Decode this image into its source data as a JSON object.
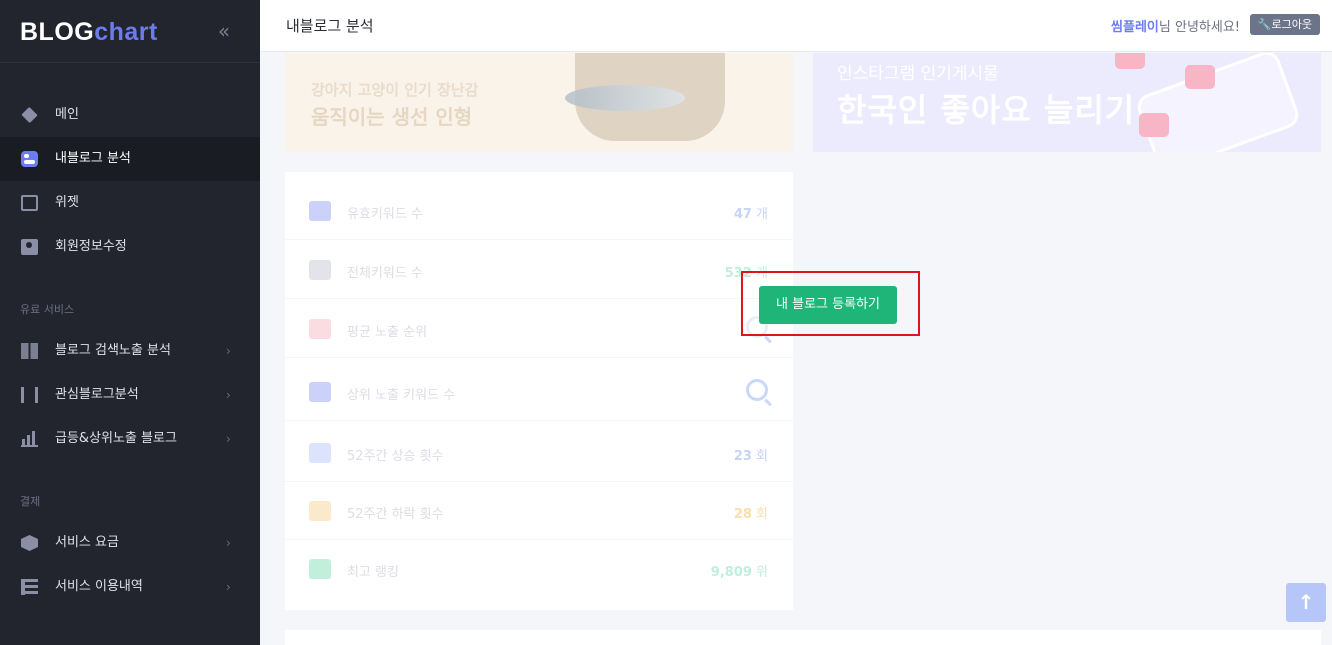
{
  "brand": {
    "part1": "BLOG",
    "part2": "chart"
  },
  "sidebar": {
    "collapse_glyph": "«",
    "items": [
      {
        "label": "메인",
        "icon": "layers-icon"
      },
      {
        "label": "내블로그 분석",
        "icon": "toggle-icon",
        "active": true
      },
      {
        "label": "위젯",
        "icon": "pulse-icon"
      },
      {
        "label": "회원정보수정",
        "icon": "user-card-icon"
      }
    ],
    "section_paid": "유료 서비스",
    "paid_items": [
      {
        "label": "블로그 검색노출 분석",
        "icon": "grid-icon"
      },
      {
        "label": "관심블로그분석",
        "icon": "frame-icon"
      },
      {
        "label": "급등&상위노출 블로그",
        "icon": "bar-chart-icon"
      }
    ],
    "section_payment": "결제",
    "payment_items": [
      {
        "label": "서비스 요금",
        "icon": "box-icon"
      },
      {
        "label": "서비스 이용내역",
        "icon": "list-icon"
      }
    ],
    "chevron": "›"
  },
  "header": {
    "title": "내블로그 분석",
    "username": "씸플레이",
    "greeting_suffix": "님 안녕하세요!",
    "logout_label": "🔧로그아웃"
  },
  "banners": {
    "left": {
      "line1": "강아지 고양이 인기 장난감",
      "line2": "움직이는 생선 인형"
    },
    "right": {
      "line1": "인스타그램 인기게시물",
      "line2": "한국인 좋아요 늘리기"
    }
  },
  "stats": [
    {
      "label": "유효키워드 수",
      "value": "47",
      "unit": " 개",
      "value_color": "#c6d4f7",
      "icon_color": "#6d7cf2",
      "icon": "bell-icon"
    },
    {
      "label": "전체키워드 수",
      "value": "532",
      "unit": " 개",
      "value_color": "#bfeedd",
      "icon_color": "#b0b3c2",
      "icon": "document-icon"
    },
    {
      "label": "평균 노출 순위",
      "value": "",
      "unit": "",
      "value_color": "#dcdde6",
      "icon_color": "#f29aa8",
      "icon": "copy-icon"
    },
    {
      "label": "상위 노출 키워드 수",
      "value": "",
      "unit": "",
      "value_color": "#dcdde6",
      "icon_color": "#6d7cf2",
      "icon": "list-doc-icon"
    },
    {
      "label": "52주간 상승 횟수",
      "value": "23",
      "unit": " 회",
      "value_color": "#c6d4f7",
      "icon_color": "#9bb0f5",
      "icon": "trend-up-icon"
    },
    {
      "label": "52주간 하락 횟수",
      "value": "28",
      "unit": " 회",
      "value_color": "#f8dfb0",
      "icon_color": "#f2c26a",
      "icon": "trend-down-icon"
    },
    {
      "label": "최고 랭킹",
      "value": "9,809",
      "unit": " 위",
      "value_color": "#bfeedd",
      "icon_color": "#4fcf9c",
      "icon": "trophy-icon"
    }
  ],
  "register_button": "내 블로그 등록하기",
  "scroll_top_glyph": "↑"
}
